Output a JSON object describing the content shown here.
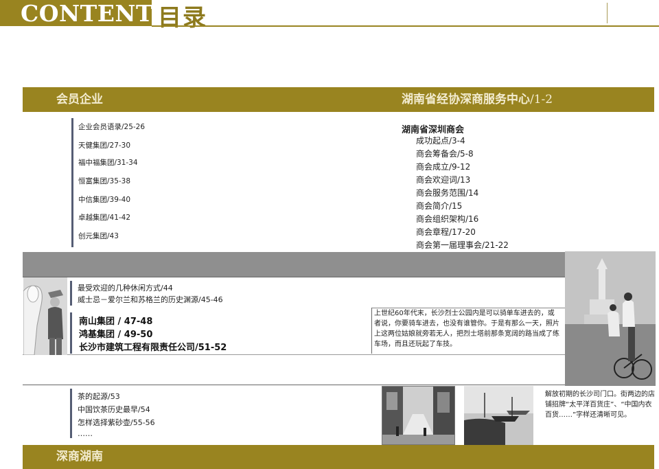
{
  "header": {
    "title": "CONTENTS",
    "title_cn": "目录"
  },
  "band_top": {
    "left": "会员企业",
    "right_text": "湖南省经协深商服务中心",
    "right_pages": "/1-2"
  },
  "members": [
    "企业会员语录/25-26",
    "天健集团/27-30",
    "福中福集团/31-34",
    "恒富集团/35-38",
    "中信集团/39-40",
    "卓越集团/41-42",
    "创元集团/43"
  ],
  "chamber": {
    "heading": "湖南省深圳商会",
    "items": [
      "成功起点/3-4",
      "商会筹备会/5-8",
      "商会成立/9-12",
      "商会欢迎词/13",
      "商会服务范围/14",
      "商会简介/15",
      "商会组织架构/16",
      "商会章程/17-20",
      "商会第一届理事会/21-22"
    ]
  },
  "section1": {
    "items": [
      "最受欢迎的几种休闲方式/44",
      "威士忌－爱尔兰和苏格兰的历史渊源/45-46"
    ],
    "companies": [
      "南山集团 / 47-48",
      "鸿基集团 / 49-50",
      "长沙市建筑工程有限责任公司/51-52"
    ],
    "caption": "上世纪60年代末，长沙烈士公园内是可以骑单车进去的，或者说，你要骑车进去，也没有谁管你。于是有那么一天，照片上这两位姑娘就旁若无人，把烈士塔前那条宽阔的路当成了练车场，而且还玩起了车技。"
  },
  "section2": {
    "items": [
      "茶的起源/53",
      "中国饮茶历史最早/54",
      "怎样选择紫砂壶/55-56",
      "……"
    ],
    "caption": "解放初期的长沙司门口。街两边的店铺招牌“太平洋百货庄”、“中国内衣百货……”字样还清晰可见。"
  },
  "band_bottom": {
    "label": "深商湖南"
  },
  "colors": {
    "gold": "#998420",
    "slate": "#555d74",
    "gray_band": "#8f8f8f"
  }
}
